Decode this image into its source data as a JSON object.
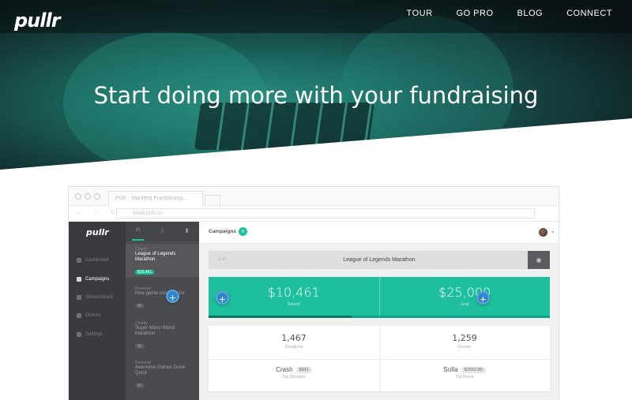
{
  "site": {
    "logo": "pullr",
    "nav": [
      "TOUR",
      "GO PRO",
      "BLOG",
      "CONNECT"
    ],
    "headline": "Start doing more with your fundraising"
  },
  "browser": {
    "tab_title": "Pullr - Manifest Fundraising...",
    "url": "www.pullr.io"
  },
  "app": {
    "logo": "pullr",
    "sidebar": [
      {
        "label": "Dashboard",
        "icon": "dashboard-icon",
        "active": false
      },
      {
        "label": "Campaigns",
        "icon": "bar-chart-icon",
        "active": true
      },
      {
        "label": "Streamboard",
        "icon": "streamboard-icon",
        "active": false
      },
      {
        "label": "Donors",
        "icon": "user-icon",
        "active": false
      },
      {
        "label": "Settings",
        "icon": "gear-icon",
        "active": false
      }
    ],
    "mid_tabs": [
      "ılı",
      "▯",
      "▮"
    ],
    "campaigns": [
      {
        "kind": "Charity",
        "title": "League of Legends Marathon",
        "amount": "$10,461",
        "selected": true
      },
      {
        "kind": "Personal",
        "title": "New game consoles for",
        "amount": "$0",
        "selected": false
      },
      {
        "kind": "Charity",
        "title": "Super Mario World Marathon",
        "amount": "$0",
        "selected": false
      },
      {
        "kind": "Personal",
        "title": "Awesome Games Done Quick",
        "amount": "$0",
        "selected": false
      }
    ],
    "header_label": "Campaigns",
    "campaign_title": "League of Legends Marathon",
    "title_options": "☰ ▾",
    "eye_icon": "◉",
    "raised": {
      "value": "$10,461",
      "label": "Raised"
    },
    "goal": {
      "value": "$25,000",
      "label": "Goal"
    },
    "progress_fraction": 0.42,
    "stats": {
      "donations": {
        "value": "1,467",
        "label": "Donations"
      },
      "donors": {
        "value": "1,259",
        "label": "Donors"
      },
      "top_donation": {
        "name": "Crash",
        "amount": "$931",
        "label": "Top Donation"
      },
      "top_donor": {
        "name": "Sofia",
        "amount": "$1552.00",
        "label": "Top Donor"
      }
    }
  },
  "colors": {
    "accent": "#1dbf9d",
    "plus_button": "#2f86d0",
    "sidebar": "#3a3b3e"
  }
}
